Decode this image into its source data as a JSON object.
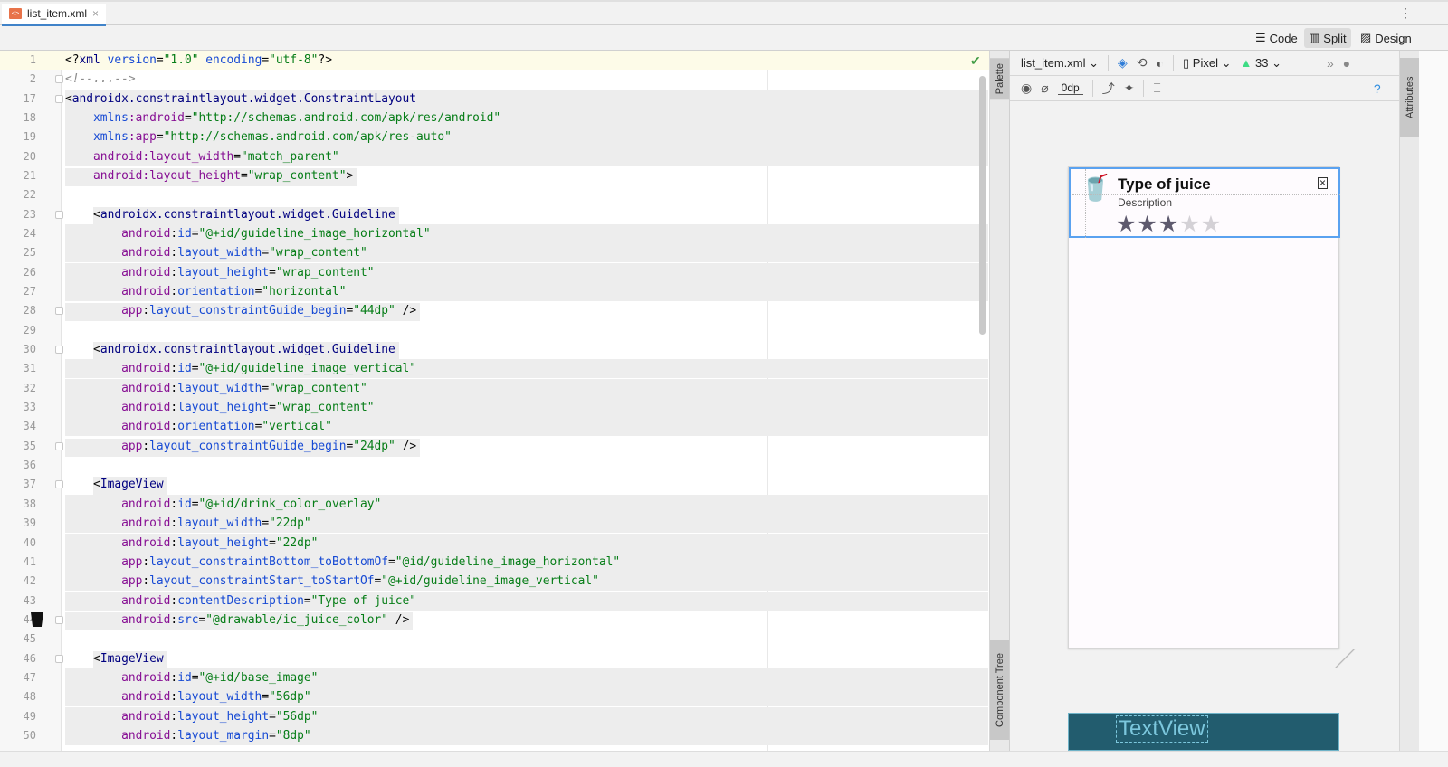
{
  "tab": {
    "filename": "list_item.xml",
    "close": "×"
  },
  "modes": {
    "code": "Code",
    "split": "Split",
    "design": "Design",
    "active": "Split"
  },
  "design_toolbar": {
    "file": "list_item.xml",
    "device": "Pixel",
    "api": "33",
    "margin": "0dp"
  },
  "side_panels": {
    "palette": "Palette",
    "component_tree": "Component Tree",
    "attributes": "Attributes"
  },
  "preview": {
    "title": "Type of juice",
    "description": "Description",
    "rating": 3,
    "max_rating": 5,
    "blueprint_label": "TextView"
  },
  "colors": {
    "accent": "#4083c9",
    "selection": "#5aa2f0",
    "blueprint": "#225c6e",
    "tag": "#000080",
    "namespace": "#871094",
    "attribute": "#174ad4",
    "value": "#067d17"
  },
  "code_lines": [
    {
      "n": "1",
      "t": [
        [
          "p",
          "<?"
        ],
        [
          "tag",
          "xml "
        ],
        [
          "attr",
          "version"
        ],
        [
          "p",
          "="
        ],
        [
          "val",
          "\"1.0\" "
        ],
        [
          "attr",
          "encoding"
        ],
        [
          "p",
          "="
        ],
        [
          "val",
          "\"utf-8\""
        ],
        [
          "p",
          "?>"
        ]
      ]
    },
    {
      "n": "2",
      "t": [
        [
          "com",
          "<!--...-->"
        ]
      ]
    },
    {
      "n": "17",
      "t": [
        [
          "p",
          "<"
        ],
        [
          "tag",
          "androidx.constraintlayout.widget.ConstraintLayout"
        ]
      ]
    },
    {
      "n": "18",
      "t": [
        [
          "p",
          "    "
        ],
        [
          "xmlns",
          "xmlns"
        ],
        [
          "ns",
          ":android"
        ],
        [
          "p",
          "="
        ],
        [
          "val",
          "\"http://schemas.android.com/apk/res/android\""
        ]
      ]
    },
    {
      "n": "19",
      "t": [
        [
          "p",
          "    "
        ],
        [
          "xmlns",
          "xmlns"
        ],
        [
          "ns",
          ":app"
        ],
        [
          "p",
          "="
        ],
        [
          "val",
          "\"http://schemas.android.com/apk/res-auto\""
        ]
      ]
    },
    {
      "n": "20",
      "t": [
        [
          "p",
          "    "
        ],
        [
          "ns",
          "android:layout_width"
        ],
        [
          "p",
          "="
        ],
        [
          "val",
          "\"match_parent\""
        ]
      ]
    },
    {
      "n": "21",
      "t": [
        [
          "p",
          "    "
        ],
        [
          "ns",
          "android:layout_height"
        ],
        [
          "p",
          "="
        ],
        [
          "val",
          "\"wrap_content\""
        ],
        [
          "p",
          ">"
        ]
      ]
    },
    {
      "n": "22",
      "t": []
    },
    {
      "n": "23",
      "t": [
        [
          "p",
          "    <"
        ],
        [
          "tag",
          "androidx.constraintlayout.widget.Guideline"
        ]
      ]
    },
    {
      "n": "24",
      "t": [
        [
          "p",
          "        "
        ],
        [
          "ns",
          "android"
        ],
        [
          "p",
          ":"
        ],
        [
          "attr",
          "id"
        ],
        [
          "p",
          "="
        ],
        [
          "val",
          "\"@+id/guideline_image_horizontal\""
        ]
      ]
    },
    {
      "n": "25",
      "t": [
        [
          "p",
          "        "
        ],
        [
          "ns",
          "android"
        ],
        [
          "p",
          ":"
        ],
        [
          "attr",
          "layout_width"
        ],
        [
          "p",
          "="
        ],
        [
          "val",
          "\"wrap_content\""
        ]
      ]
    },
    {
      "n": "26",
      "t": [
        [
          "p",
          "        "
        ],
        [
          "ns",
          "android"
        ],
        [
          "p",
          ":"
        ],
        [
          "attr",
          "layout_height"
        ],
        [
          "p",
          "="
        ],
        [
          "val",
          "\"wrap_content\""
        ]
      ]
    },
    {
      "n": "27",
      "t": [
        [
          "p",
          "        "
        ],
        [
          "ns",
          "android"
        ],
        [
          "p",
          ":"
        ],
        [
          "attr",
          "orientation"
        ],
        [
          "p",
          "="
        ],
        [
          "val",
          "\"horizontal\""
        ]
      ]
    },
    {
      "n": "28",
      "t": [
        [
          "p",
          "        "
        ],
        [
          "ns",
          "app"
        ],
        [
          "p",
          ":"
        ],
        [
          "attr",
          "layout_constraintGuide_begin"
        ],
        [
          "p",
          "="
        ],
        [
          "val",
          "\"44dp\""
        ],
        [
          "p",
          " />"
        ]
      ]
    },
    {
      "n": "29",
      "t": []
    },
    {
      "n": "30",
      "t": [
        [
          "p",
          "    <"
        ],
        [
          "tag",
          "androidx.constraintlayout.widget.Guideline"
        ]
      ]
    },
    {
      "n": "31",
      "t": [
        [
          "p",
          "        "
        ],
        [
          "ns",
          "android"
        ],
        [
          "p",
          ":"
        ],
        [
          "attr",
          "id"
        ],
        [
          "p",
          "="
        ],
        [
          "val",
          "\"@+id/guideline_image_vertical\""
        ]
      ]
    },
    {
      "n": "32",
      "t": [
        [
          "p",
          "        "
        ],
        [
          "ns",
          "android"
        ],
        [
          "p",
          ":"
        ],
        [
          "attr",
          "layout_width"
        ],
        [
          "p",
          "="
        ],
        [
          "val",
          "\"wrap_content\""
        ]
      ]
    },
    {
      "n": "33",
      "t": [
        [
          "p",
          "        "
        ],
        [
          "ns",
          "android"
        ],
        [
          "p",
          ":"
        ],
        [
          "attr",
          "layout_height"
        ],
        [
          "p",
          "="
        ],
        [
          "val",
          "\"wrap_content\""
        ]
      ]
    },
    {
      "n": "34",
      "t": [
        [
          "p",
          "        "
        ],
        [
          "ns",
          "android"
        ],
        [
          "p",
          ":"
        ],
        [
          "attr",
          "orientation"
        ],
        [
          "p",
          "="
        ],
        [
          "val",
          "\"vertical\""
        ]
      ]
    },
    {
      "n": "35",
      "t": [
        [
          "p",
          "        "
        ],
        [
          "ns",
          "app"
        ],
        [
          "p",
          ":"
        ],
        [
          "attr",
          "layout_constraintGuide_begin"
        ],
        [
          "p",
          "="
        ],
        [
          "val",
          "\"24dp\""
        ],
        [
          "p",
          " />"
        ]
      ]
    },
    {
      "n": "36",
      "t": []
    },
    {
      "n": "37",
      "t": [
        [
          "p",
          "    <"
        ],
        [
          "tag",
          "ImageView"
        ]
      ]
    },
    {
      "n": "38",
      "t": [
        [
          "p",
          "        "
        ],
        [
          "ns",
          "android"
        ],
        [
          "p",
          ":"
        ],
        [
          "attr",
          "id"
        ],
        [
          "p",
          "="
        ],
        [
          "val",
          "\"@+id/drink_color_overlay\""
        ]
      ]
    },
    {
      "n": "39",
      "t": [
        [
          "p",
          "        "
        ],
        [
          "ns",
          "android"
        ],
        [
          "p",
          ":"
        ],
        [
          "attr",
          "layout_width"
        ],
        [
          "p",
          "="
        ],
        [
          "val",
          "\"22dp\""
        ]
      ]
    },
    {
      "n": "40",
      "t": [
        [
          "p",
          "        "
        ],
        [
          "ns",
          "android"
        ],
        [
          "p",
          ":"
        ],
        [
          "attr",
          "layout_height"
        ],
        [
          "p",
          "="
        ],
        [
          "val",
          "\"22dp\""
        ]
      ]
    },
    {
      "n": "41",
      "t": [
        [
          "p",
          "        "
        ],
        [
          "ns",
          "app"
        ],
        [
          "p",
          ":"
        ],
        [
          "attr",
          "layout_constraintBottom_toBottomOf"
        ],
        [
          "p",
          "="
        ],
        [
          "val",
          "\"@id/guideline_image_horizontal\""
        ]
      ]
    },
    {
      "n": "42",
      "t": [
        [
          "p",
          "        "
        ],
        [
          "ns",
          "app"
        ],
        [
          "p",
          ":"
        ],
        [
          "attr",
          "layout_constraintStart_toStartOf"
        ],
        [
          "p",
          "="
        ],
        [
          "val",
          "\"@+id/guideline_image_vertical\""
        ]
      ]
    },
    {
      "n": "43",
      "t": [
        [
          "p",
          "        "
        ],
        [
          "ns",
          "android"
        ],
        [
          "p",
          ":"
        ],
        [
          "attr",
          "contentDescription"
        ],
        [
          "p",
          "="
        ],
        [
          "val",
          "\"Type of juice\""
        ]
      ]
    },
    {
      "n": "44",
      "t": [
        [
          "p",
          "        "
        ],
        [
          "ns",
          "android"
        ],
        [
          "p",
          ":"
        ],
        [
          "attr",
          "src"
        ],
        [
          "p",
          "="
        ],
        [
          "val",
          "\"@drawable/ic_juice_color\""
        ],
        [
          "p",
          " />"
        ]
      ]
    },
    {
      "n": "45",
      "t": []
    },
    {
      "n": "46",
      "t": [
        [
          "p",
          "    <"
        ],
        [
          "tag",
          "ImageView"
        ]
      ]
    },
    {
      "n": "47",
      "t": [
        [
          "p",
          "        "
        ],
        [
          "ns",
          "android"
        ],
        [
          "p",
          ":"
        ],
        [
          "attr",
          "id"
        ],
        [
          "p",
          "="
        ],
        [
          "val",
          "\"@+id/base_image\""
        ]
      ]
    },
    {
      "n": "48",
      "t": [
        [
          "p",
          "        "
        ],
        [
          "ns",
          "android"
        ],
        [
          "p",
          ":"
        ],
        [
          "attr",
          "layout_width"
        ],
        [
          "p",
          "="
        ],
        [
          "val",
          "\"56dp\""
        ]
      ]
    },
    {
      "n": "49",
      "t": [
        [
          "p",
          "        "
        ],
        [
          "ns",
          "android"
        ],
        [
          "p",
          ":"
        ],
        [
          "attr",
          "layout_height"
        ],
        [
          "p",
          "="
        ],
        [
          "val",
          "\"56dp\""
        ]
      ]
    },
    {
      "n": "50",
      "t": [
        [
          "p",
          "        "
        ],
        [
          "ns",
          "android"
        ],
        [
          "p",
          ":"
        ],
        [
          "attr",
          "layout_margin"
        ],
        [
          "p",
          "="
        ],
        [
          "val",
          "\"8dp\""
        ]
      ]
    }
  ]
}
